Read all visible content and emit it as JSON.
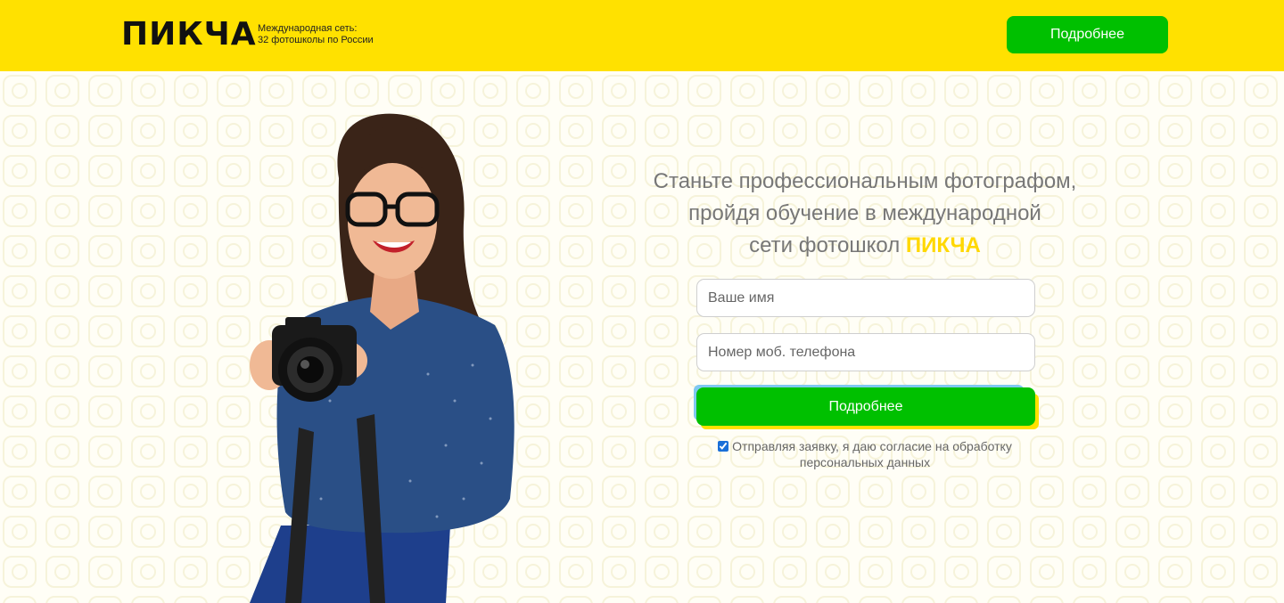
{
  "header": {
    "logo": "ПИКЧА",
    "tagline_line1": "Международная сеть:",
    "tagline_line2": "32 фотошколы по России",
    "cta_label": "Подробнее"
  },
  "hero": {
    "headline_line1": "Станьте профессиональным фотографом,",
    "headline_line2": "пройдя обучение в международной",
    "headline_line3_prefix": "сети фотошкол ",
    "headline_brand": "ПИКЧА"
  },
  "form": {
    "name_placeholder": "Ваше имя",
    "phone_placeholder": "Номер моб. телефона",
    "submit_label": "Подробнее",
    "consent_checked": true,
    "consent_text": "Отправляя заявку, я даю согласие на обработку персональных данных"
  },
  "colors": {
    "brand_yellow": "#ffe100",
    "accent_green": "#00c000",
    "text_gray": "#777777"
  }
}
